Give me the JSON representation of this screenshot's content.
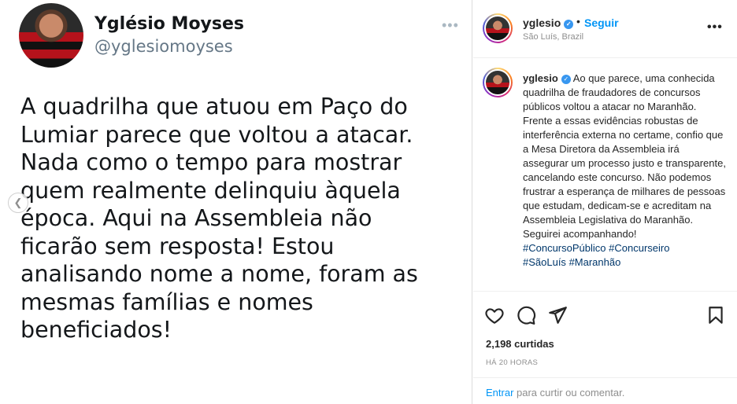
{
  "tweet": {
    "name": "Yglésio Moyses",
    "handle": "@yglesiomoyses",
    "text": "A quadrilha que atuou em Paço do\nLumiar parece que voltou a atacar.\nNada como o tempo para mostrar\nquem realmente delinquiu àquela\népoca. Aqui na Assembleia não\nficarão sem resposta! Estou\nanalisando nome a nome, foram as\nmesmas famílias  e nomes\nbeneficiados!"
  },
  "post": {
    "username": "yglesio",
    "follow_label": "Seguir",
    "separator": "•",
    "location": "São Luís, Brazil",
    "more": "•••",
    "caption_text": "Ao que parece, uma conhecida quadrilha de fraudadores de concursos públicos voltou a atacar no Maranhão. Frente a essas evidências robustas de interferência externa no certame, confio que a Mesa Diretora da Assembleia irá assegurar um processo justo e transparente, cancelando este concurso. Não podemos frustrar a esperança de milhares de pessoas que estudam, dedicam-se e acreditam na Assembleia Legislativa do Maranhão. Seguirei acompanhando!",
    "hashtags": [
      "#ConcursoPúblico",
      "#Concurseiro",
      "#SãoLuís",
      "#Maranhão"
    ],
    "likes": "2,198 curtidas",
    "time": "HÁ 20 HORAS",
    "comment_enter": "Entrar",
    "comment_rest": " para curtir ou comentar."
  },
  "colors": {
    "link_blue": "#0095f6",
    "hashtag": "#00376b",
    "muted": "#8e8e8e",
    "verified": "#3897f0"
  },
  "icons": [
    "heart-icon",
    "comment-icon",
    "share-icon",
    "bookmark-icon",
    "verified-icon",
    "more-icon",
    "chevron-left-icon"
  ]
}
